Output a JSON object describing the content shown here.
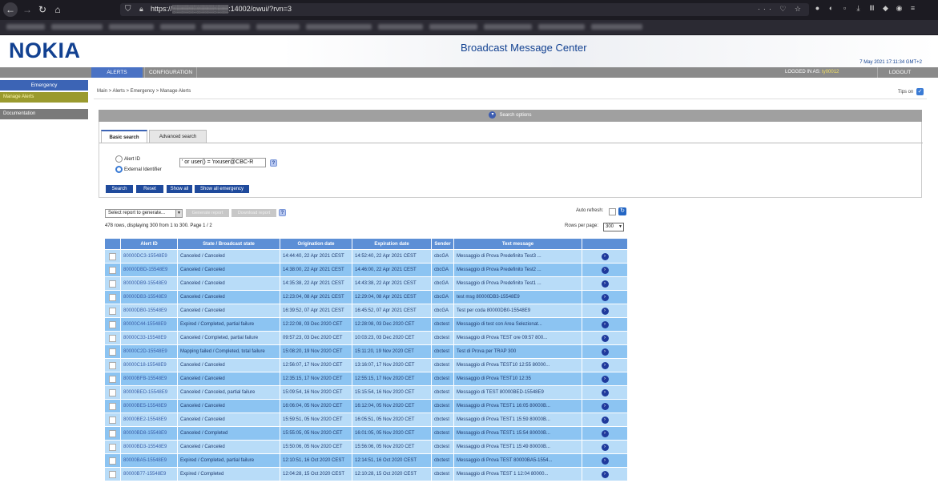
{
  "browser": {
    "url": "https://▒▒▒▒▒▒▒▒▒▒▒:14002/owui/?rvn=3",
    "toolbar_right": "··· ♡ ☆"
  },
  "header": {
    "logo": "NOKIA",
    "title": "Broadcast Message Center",
    "datetime": "7 May 2021 17:11:34 GMT+2"
  },
  "menubar": {
    "alerts": "ALERTS",
    "configuration": "CONFIGURATION",
    "logged_in_label": "LOGGED IN AS:",
    "logged_in_user": "ty00012",
    "logout": "LOGOUT"
  },
  "sidebar": {
    "heading": "Emergency",
    "items": [
      "Manage Alerts",
      "Documentation"
    ]
  },
  "breadcrumb": {
    "path": "Main  >  Alerts  >  Emergency  >  Manage Alerts",
    "tips_label": "Tips on"
  },
  "search": {
    "bar_label": "Search options",
    "tabs": [
      "Basic search",
      "Advanced search"
    ],
    "radio_alert_id": "Alert ID",
    "radio_external_id": "External Identifier",
    "input_value": "' or user() = 'nxuser@CBC-R",
    "help": "?",
    "buttons": {
      "search": "Search",
      "reset": "Reset",
      "show_all": "Show all",
      "show_all_emergency": "Show all emergency"
    }
  },
  "report": {
    "select_placeholder": "Select report to generate...",
    "generate": "Generate report",
    "download": "Download report",
    "auto_refresh": "Auto refresh:",
    "rows_info": "478 rows, displaying 300 from 1 to 300. Page 1 / 2",
    "rows_per_page_label": "Rows per page:",
    "rows_per_page": "300"
  },
  "table": {
    "columns": [
      "",
      "Alert ID",
      "State / Broadcast state",
      "Origination date",
      "Expiration date",
      "Sender",
      "Text message",
      ""
    ],
    "rows": [
      [
        "80000DC3-15548E9",
        "Canceled / Canceled",
        "14:44:40, 22 Apr 2021 CEST",
        "14:52:40, 22 Apr 2021 CEST",
        "cbcGA",
        "Messaggio di Prova Predefinito Test3 ..."
      ],
      [
        "80000DBD-15548E9",
        "Canceled / Canceled",
        "14:38:00, 22 Apr 2021 CEST",
        "14:46:00, 22 Apr 2021 CEST",
        "cbcGA",
        "Messaggio di Prova Predefinito Test2 ..."
      ],
      [
        "80000DB9-15548E9",
        "Canceled / Canceled",
        "14:35:38, 22 Apr 2021 CEST",
        "14:43:38, 22 Apr 2021 CEST",
        "cbcGA",
        "Messaggio di Prova Predefinito Test1 ..."
      ],
      [
        "80000DB3-15548E9",
        "Canceled / Canceled",
        "12:23:04, 08 Apr 2021 CEST",
        "12:29:04, 08 Apr 2021 CEST",
        "cbcGA",
        "test msg 80000DB3-15548E9"
      ],
      [
        "80000DB0-15548E9",
        "Canceled / Canceled",
        "16:39:52, 07 Apr 2021 CEST",
        "16:45:52, 07 Apr 2021 CEST",
        "cbcGA",
        "Test per coda 80000DB0-15548E9"
      ],
      [
        "80000C44-15548E9",
        "Expired / Completed, partial failure",
        "12:22:08, 03 Dec 2020 CET",
        "12:28:08, 03 Dec 2020 CET",
        "cbctest",
        "Messaggio di test con Area Selezionat..."
      ],
      [
        "80000C33-15548E9",
        "Canceled / Completed, partial failure",
        "09:57:23, 03 Dec 2020 CET",
        "10:03:23, 03 Dec 2020 CET",
        "cbctest",
        "Messaggio di Prova TEST ore 09:57 800..."
      ],
      [
        "80000C2D-15548E9",
        "Mapping failed / Completed, total failure",
        "15:08:20, 19 Nov 2020 CET",
        "15:11:20, 19 Nov 2020 CET",
        "cbctest",
        "Test di Prova per TRAP 300"
      ],
      [
        "80000C18-15548E9",
        "Canceled / Canceled",
        "12:56:07, 17 Nov 2020 CET",
        "13:16:07, 17 Nov 2020 CET",
        "cbctest",
        "Messaggio di Prova TEST10 12:55 80000..."
      ],
      [
        "80000BFB-15548E9",
        "Canceled / Canceled",
        "12:35:15, 17 Nov 2020 CET",
        "12:55:15, 17 Nov 2020 CET",
        "cbctest",
        "Messaggio di Prova TEST10 12:35"
      ],
      [
        "80000BED-15548E9",
        "Canceled / Canceled, partial failure",
        "15:09:54, 16 Nov 2020 CET",
        "15:15:54, 16 Nov 2020 CET",
        "cbctest",
        "Messaggio di TEST 80000BED-15548E9"
      ],
      [
        "80000BE5-15548E9",
        "Canceled / Canceled",
        "16:06:04, 05 Nov 2020 CET",
        "16:12:04, 05 Nov 2020 CET",
        "cbctest",
        "Messaggio di Prova TEST1 16:05 80000B..."
      ],
      [
        "80000BE2-15548E9",
        "Canceled / Canceled",
        "15:59:51, 05 Nov 2020 CET",
        "16:05:51, 05 Nov 2020 CET",
        "cbctest",
        "Messaggio di Prova TEST1 15:59 80000B..."
      ],
      [
        "80000BD8-15548E9",
        "Canceled / Completed",
        "15:55:05, 05 Nov 2020 CET",
        "16:01:05, 05 Nov 2020 CET",
        "cbctest",
        "Messaggio di Prova TEST1 15:54 80000B..."
      ],
      [
        "80000BD3-15548E9",
        "Canceled / Canceled",
        "15:50:06, 05 Nov 2020 CET",
        "15:56:06, 05 Nov 2020 CET",
        "cbctest",
        "Messaggio di Prova TEST1 15:49 80000B..."
      ],
      [
        "80000BA5-15548E9",
        "Expired / Completed, partial failure",
        "12:10:51, 16 Oct 2020 CEST",
        "12:14:51, 16 Oct 2020 CEST",
        "cbctest",
        "Messaggio di Prova TEST 80000BA5-1554..."
      ],
      [
        "80000B77-15548E9",
        "Expired / Completed",
        "12:04:28, 15 Oct 2020 CEST",
        "12:10:28, 15 Oct 2020 CEST",
        "cbctest",
        "Messaggio di Prova TEST 1 12:04 80000..."
      ]
    ]
  }
}
